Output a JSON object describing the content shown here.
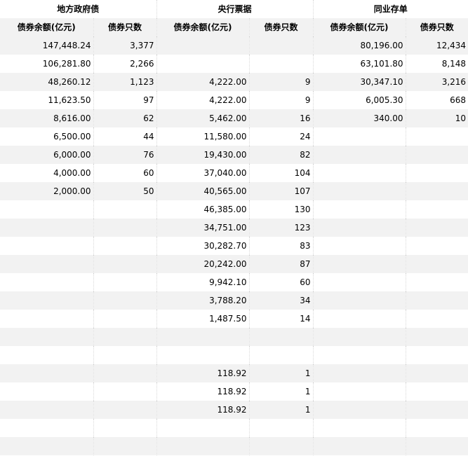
{
  "groups": [
    "地方政府债",
    "央行票据",
    "同业存单"
  ],
  "subheaders": [
    "债券余额(亿元)",
    "债券只数",
    "债券余额(亿元)",
    "债券只数",
    "债券余额(亿元)",
    "债券只数"
  ],
  "rows": [
    [
      "147,448.24",
      "3,377",
      "",
      "",
      "80,196.00",
      "12,434"
    ],
    [
      "106,281.80",
      "2,266",
      "",
      "",
      "63,101.80",
      "8,148"
    ],
    [
      "48,260.12",
      "1,123",
      "4,222.00",
      "9",
      "30,347.10",
      "3,216"
    ],
    [
      "11,623.50",
      "97",
      "4,222.00",
      "9",
      "6,005.30",
      "668"
    ],
    [
      "8,616.00",
      "62",
      "5,462.00",
      "16",
      "340.00",
      "10"
    ],
    [
      "6,500.00",
      "44",
      "11,580.00",
      "24",
      "",
      ""
    ],
    [
      "6,000.00",
      "76",
      "19,430.00",
      "82",
      "",
      ""
    ],
    [
      "4,000.00",
      "60",
      "37,040.00",
      "104",
      "",
      ""
    ],
    [
      "2,000.00",
      "50",
      "40,565.00",
      "107",
      "",
      ""
    ],
    [
      "",
      "",
      "46,385.00",
      "130",
      "",
      ""
    ],
    [
      "",
      "",
      "34,751.00",
      "123",
      "",
      ""
    ],
    [
      "",
      "",
      "30,282.70",
      "83",
      "",
      ""
    ],
    [
      "",
      "",
      "20,242.00",
      "87",
      "",
      ""
    ],
    [
      "",
      "",
      "9,942.10",
      "60",
      "",
      ""
    ],
    [
      "",
      "",
      "3,788.20",
      "34",
      "",
      ""
    ],
    [
      "",
      "",
      "1,487.50",
      "14",
      "",
      ""
    ],
    [
      "",
      "",
      "",
      "",
      "",
      ""
    ],
    [
      "",
      "",
      "",
      "",
      "",
      ""
    ],
    [
      "",
      "",
      "118.92",
      "1",
      "",
      ""
    ],
    [
      "",
      "",
      "118.92",
      "1",
      "",
      ""
    ],
    [
      "",
      "",
      "118.92",
      "1",
      "",
      ""
    ],
    [
      "",
      "",
      "",
      "",
      "",
      ""
    ],
    [
      "",
      "",
      "",
      "",
      "",
      ""
    ]
  ]
}
